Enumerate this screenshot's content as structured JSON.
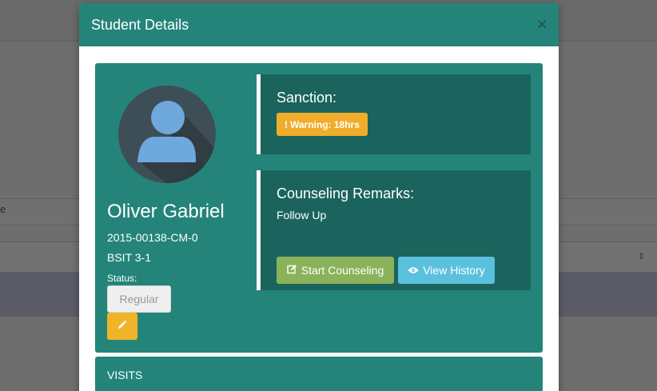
{
  "modal": {
    "title": "Student Details",
    "close_label": "×"
  },
  "student": {
    "name": "Oliver Gabriel",
    "id": "2015-00138-CM-0",
    "course": "BSIT 3-1",
    "status_label": "Status:",
    "status_value": "Regular"
  },
  "sanction": {
    "title": "Sanction:",
    "badge_icon": "!",
    "badge_text": "Warning: 18hrs"
  },
  "remarks": {
    "title": "Counseling Remarks:",
    "text": "Follow Up",
    "start_label": "Start Counseling",
    "history_label": "View History"
  },
  "visits": {
    "title": "VISITS"
  },
  "background": {
    "letter": "e",
    "sort_glyph": "⇕"
  },
  "icons": {
    "avatar": "user-avatar-icon",
    "edit": "pencil-icon",
    "start": "edit-square-icon",
    "history": "eye-icon",
    "close": "close-icon"
  },
  "colors": {
    "primary": "#24847a",
    "panel": "#1a645d",
    "warning": "#f0ad2a",
    "success": "#8ab25a",
    "info": "#5bc0de",
    "edit": "#f0b429"
  }
}
